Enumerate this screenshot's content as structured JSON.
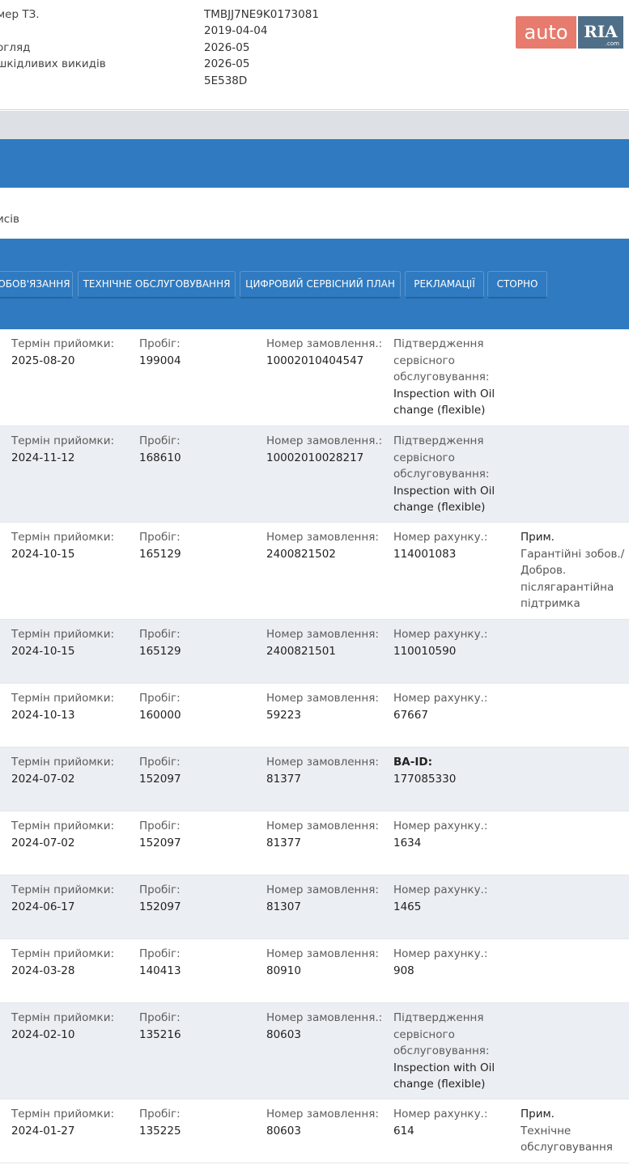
{
  "vehicle_info": {
    "rows": [
      {
        "label": "мер ТЗ.",
        "value": "TMBJJ7NE9K0173081"
      },
      {
        "label": "",
        "value": "2019-04-04"
      },
      {
        "label": "огляд",
        "value": "2026-05"
      },
      {
        "label": "шкідливих викидів",
        "value": "2026-05"
      },
      {
        "label": "",
        "value": "5E538D"
      }
    ]
  },
  "logo": {
    "auto": "auto",
    "ria": "RIA",
    "domain": ".com"
  },
  "section": {
    "label": "исів"
  },
  "tabs": [
    {
      "label": "ОБОВ'ЯЗАННЯ"
    },
    {
      "label": "ТЕХНІЧНЕ ОБСЛУГОВУВАННЯ"
    },
    {
      "label": "ЦИФРОВИЙ СЕРВІСНИЙ ПЛАН"
    },
    {
      "label": "РЕКЛАМАЦІЇ"
    },
    {
      "label": "СТОРНО"
    }
  ],
  "labels": {
    "date": "Термін прийомки:",
    "mileage": "Пробіг:",
    "order": "Номер замовлення:",
    "order_dot": "Номер замовлення.:",
    "invoice": "Номер рахунку.:",
    "confirm": "Підтвердження сервісного обслуговування:",
    "baid": "BA-ID",
    "note": "Прим."
  },
  "records": [
    {
      "date": "2025-08-20",
      "mileage": "199004",
      "order_label": "Номер замовлення.:",
      "order": "10002010404547",
      "f4_label": "Підтвердження сервісного обслуговування:",
      "f4_value": "Inspection with Oil change (flexible)",
      "note_label": "",
      "note": ""
    },
    {
      "date": "2024-11-12",
      "mileage": "168610",
      "order_label": "Номер замовлення.:",
      "order": "10002010028217",
      "f4_label": "Підтвердження сервісного обслуговування:",
      "f4_value": "Inspection with Oil change (flexible)",
      "note_label": "",
      "note": ""
    },
    {
      "date": "2024-10-15",
      "mileage": "165129",
      "order_label": "Номер замовлення:",
      "order": "2400821502",
      "f4_label": "Номер рахунку.:",
      "f4_value": "114001083",
      "note_label": "Прим.",
      "note": "Гарантійні зобов./ Добров. післягарантійна підтримка"
    },
    {
      "date": "2024-10-15",
      "mileage": "165129",
      "order_label": "Номер замовлення:",
      "order": "2400821501",
      "f4_label": "Номер рахунку.:",
      "f4_value": "110010590",
      "note_label": "",
      "note": ""
    },
    {
      "date": "2024-10-13",
      "mileage": "160000",
      "order_label": "Номер замовлення:",
      "order": "59223",
      "f4_label": "Номер рахунку.:",
      "f4_value": "67667",
      "note_label": "",
      "note": ""
    },
    {
      "date": "2024-07-02",
      "mileage": "152097",
      "order_label": "Номер замовлення:",
      "order": "81377",
      "f4_label": "BA-ID:",
      "f4_value": "177085330",
      "note_label": "",
      "note": ""
    },
    {
      "date": "2024-07-02",
      "mileage": "152097",
      "order_label": "Номер замовлення:",
      "order": "81377",
      "f4_label": "Номер рахунку.:",
      "f4_value": "1634",
      "note_label": "",
      "note": ""
    },
    {
      "date": "2024-06-17",
      "mileage": "152097",
      "order_label": "Номер замовлення:",
      "order": "81307",
      "f4_label": "Номер рахунку.:",
      "f4_value": "1465",
      "note_label": "",
      "note": ""
    },
    {
      "date": "2024-03-28",
      "mileage": "140413",
      "order_label": "Номер замовлення:",
      "order": "80910",
      "f4_label": "Номер рахунку.:",
      "f4_value": "908",
      "note_label": "",
      "note": ""
    },
    {
      "date": "2024-02-10",
      "mileage": "135216",
      "order_label": "Номер замовлення.:",
      "order": "80603",
      "f4_label": "Підтвердження сервісного обслуговування:",
      "f4_value": "Inspection with Oil change (flexible)",
      "note_label": "",
      "note": ""
    },
    {
      "date": "2024-01-27",
      "mileage": "135225",
      "order_label": "Номер замовлення:",
      "order": "80603",
      "f4_label": "Номер рахунку.:",
      "f4_value": "614",
      "note_label": "Прим.",
      "note": "Технічне обслуговування"
    }
  ]
}
